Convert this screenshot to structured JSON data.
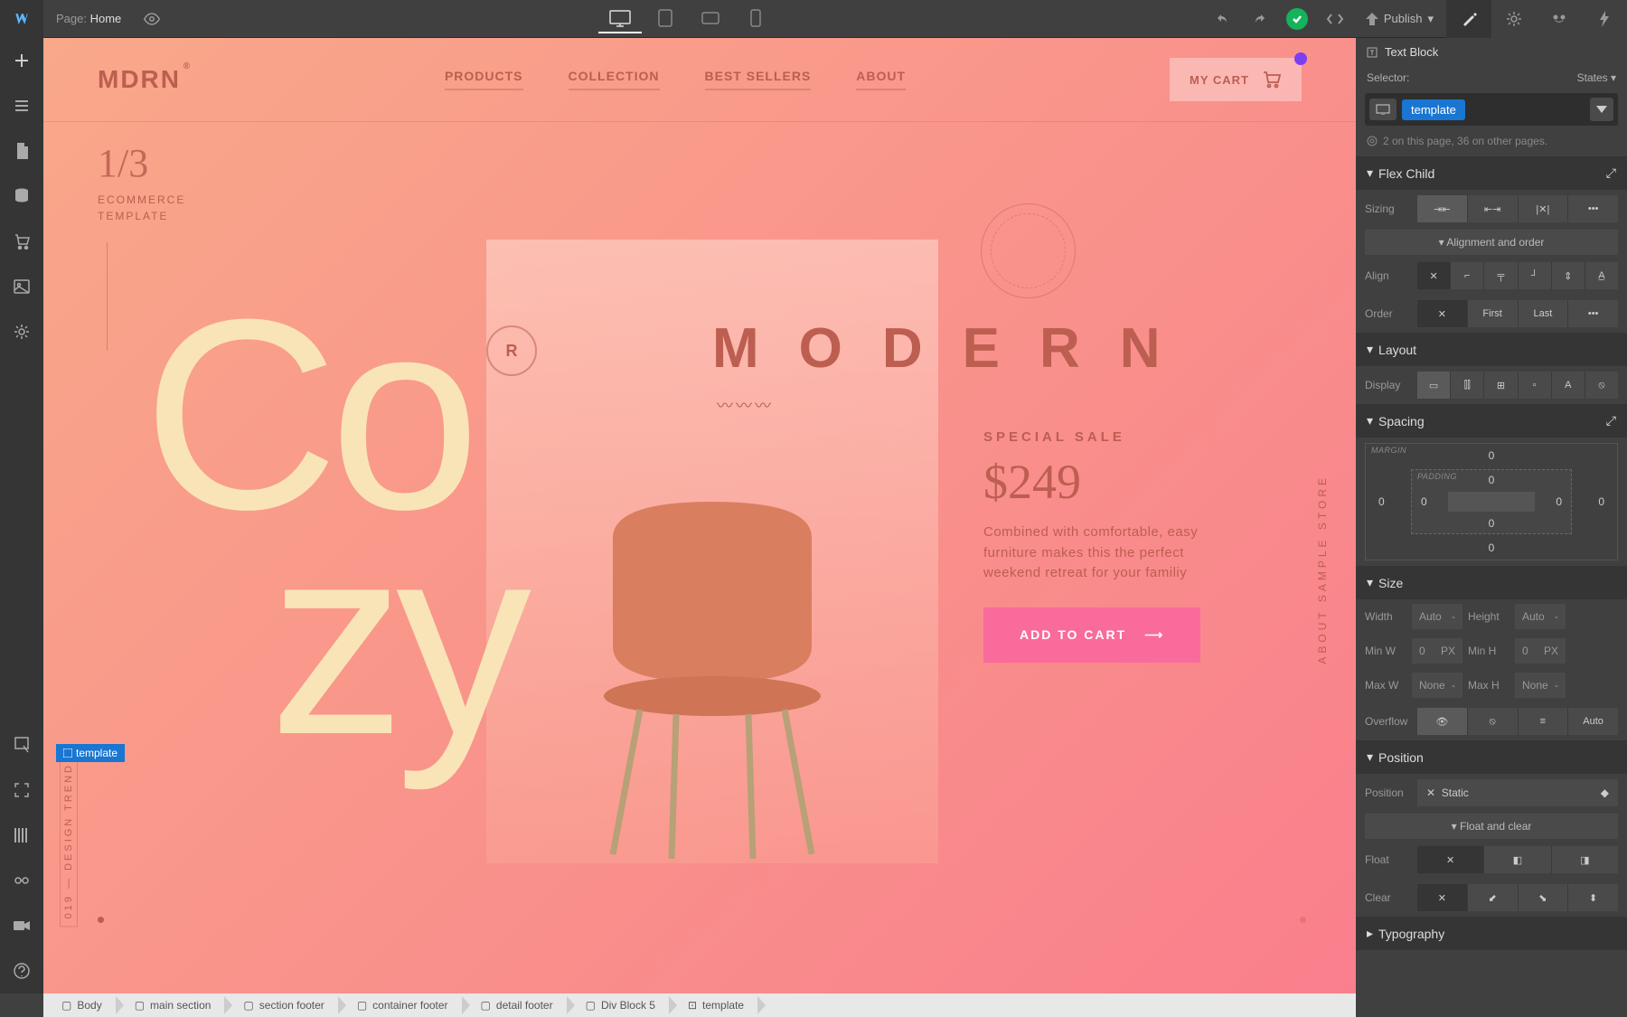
{
  "topbar": {
    "page_label": "Page:",
    "page_name": "Home",
    "publish_label": "Publish"
  },
  "site": {
    "brand": "MDRN",
    "nav": [
      "PRODUCTS",
      "COLLECTION",
      "BEST SELLERS",
      "ABOUT"
    ],
    "cart_label": "MY CART",
    "counter": "1/3",
    "ecom_label1": "ECOMMERCE",
    "ecom_label2": "TEMPLATE",
    "hero_word": "Co",
    "hero_word2": "zy",
    "modern": "MODERN",
    "badge_r": "R",
    "sale_label": "SPECIAL SALE",
    "price": "$249",
    "sale_desc": "Combined with comfortable, easy furniture makes this the perfect weekend retreat for your familiy",
    "add_cart": "ADD TO CART",
    "side_label": "ABOUT SAMPLE STORE",
    "year_label": "019 — DESIGN TREND",
    "sel_tag": "template"
  },
  "style": {
    "element_type": "Text Block",
    "selector_label": "Selector:",
    "states_label": "States",
    "token": "template",
    "info_line": "2 on this page, 36 on other pages.",
    "sections": {
      "flex_child": "Flex Child",
      "layout": "Layout",
      "spacing": "Spacing",
      "size": "Size",
      "position": "Position",
      "typography": "Typography"
    },
    "sub_alignment": "Alignment and order",
    "sub_float": "Float and clear",
    "labels": {
      "sizing": "Sizing",
      "align": "Align",
      "order": "Order",
      "display": "Display",
      "width": "Width",
      "height": "Height",
      "minw": "Min W",
      "minh": "Min H",
      "maxw": "Max W",
      "maxh": "Max H",
      "overflow": "Overflow",
      "position": "Position",
      "float": "Float",
      "clear": "Clear"
    },
    "order_first": "First",
    "order_last": "Last",
    "margin_label": "MARGIN",
    "padding_label": "PADDING",
    "margin": {
      "t": "0",
      "r": "0",
      "b": "0",
      "l": "0"
    },
    "padding": {
      "t": "0",
      "r": "0",
      "b": "0",
      "l": "0"
    },
    "size_vals": {
      "width": "Auto",
      "height": "Auto",
      "minw": "0",
      "minh": "0",
      "maxw": "None",
      "maxh": "None",
      "unit": "PX"
    },
    "overflow_auto": "Auto",
    "position_val": "Static"
  },
  "breadcrumb": [
    "Body",
    "main section",
    "section footer",
    "container footer",
    "detail footer",
    "Div Block 5",
    "template"
  ]
}
